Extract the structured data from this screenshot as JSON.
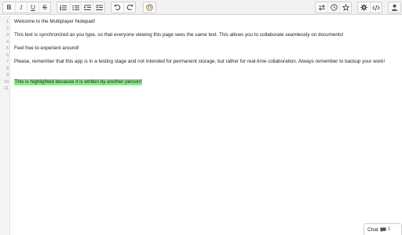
{
  "toolbar": {
    "bold_label": "B",
    "italic_label": "I",
    "underline_label": "U",
    "strike_label": "S"
  },
  "editor": {
    "lines": [
      {
        "num": "1",
        "text": "Welcome to the Multiplayer Notepad!"
      },
      {
        "num": "2",
        "text": ""
      },
      {
        "num": "3",
        "text": "This text is synchronized as you type, so that everyone viewing this page sees the same text. This allows you to collaborate seamlessly on documents!"
      },
      {
        "num": "4",
        "text": ""
      },
      {
        "num": "5",
        "text": "Feel free to experient around!"
      },
      {
        "num": "6",
        "text": ""
      },
      {
        "num": "7",
        "text": "Please, remember that this app is in a testing stage and not intended for permanent storage, but rather for real-time collaboration. Always remember to backup your work!"
      },
      {
        "num": "8",
        "text": ""
      },
      {
        "num": "9",
        "text": ""
      },
      {
        "num": "10",
        "text": "This is highlighted because it is written by another person!"
      },
      {
        "num": "11",
        "text": ""
      }
    ],
    "highlight_color": "#8ee98e"
  },
  "chat": {
    "label": "Chat",
    "count": "0"
  }
}
